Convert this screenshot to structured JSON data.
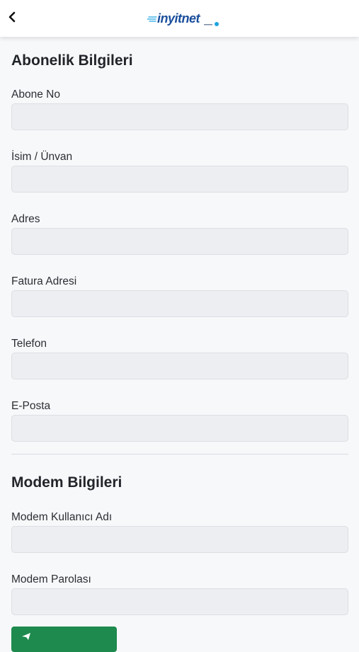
{
  "header": {
    "back_icon": "chevron-left-icon",
    "logo_text": "inyitnet",
    "logo_icon": "inyitnet-logo"
  },
  "subscription": {
    "title": "Abonelik Bilgileri",
    "fields": [
      {
        "label": "Abone No",
        "value": ""
      },
      {
        "label": "İsim / Ünvan",
        "value": ""
      },
      {
        "label": "Adres",
        "value": ""
      },
      {
        "label": "Fatura Adresi",
        "value": ""
      },
      {
        "label": "Telefon",
        "value": ""
      },
      {
        "label": "E-Posta",
        "value": ""
      }
    ]
  },
  "modem": {
    "title": "Modem Bilgileri",
    "fields": [
      {
        "label": "Modem Kullanıcı Adı",
        "value": ""
      },
      {
        "label": "Modem Parolası",
        "value": ""
      }
    ]
  },
  "colors": {
    "accent_green": "#1e8a4e",
    "logo_blue": "#1a4e9c",
    "logo_cyan": "#1fa3e0"
  }
}
